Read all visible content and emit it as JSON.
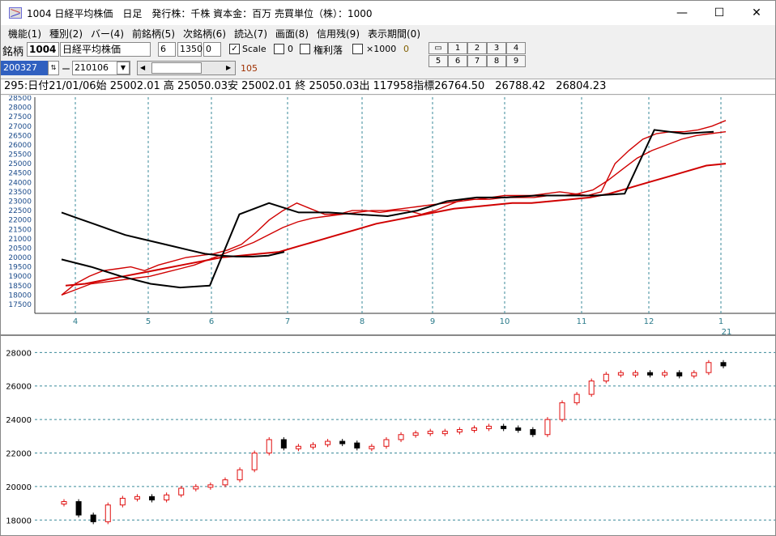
{
  "window": {
    "title": "1004 日経平均株価　日足　発行株：千株 資本金：百万 売買単位（株）：1000",
    "minimize": "—",
    "maximize": "☐",
    "close": "✕"
  },
  "menu": [
    {
      "label": "機能(1)"
    },
    {
      "label": "種別(2)"
    },
    {
      "label": "バー(4)"
    },
    {
      "label": "前銘柄(5)"
    },
    {
      "label": "次銘柄(6)"
    },
    {
      "label": "読込(7)"
    },
    {
      "label": "画面(8)"
    },
    {
      "label": "信用残(9)"
    },
    {
      "label": "表示期間(0)"
    }
  ],
  "toolbar": {
    "code_label": "銘柄",
    "code_value": "1004",
    "name_value": "日経平均株価",
    "param1": "6",
    "param2": "1350",
    "param3": "0",
    "scale_checked": "✓",
    "scale_label": "Scale",
    "zero_label": "0",
    "rights_label": "権利落",
    "x1000_label": "×1000",
    "x1000_value": "0",
    "start_date": "200327",
    "dash": "ー",
    "end_date": "210106",
    "dropdown_arrow": "▼",
    "scroll_left": "◀",
    "scroll_right": "▶",
    "count": "105",
    "num_buttons": [
      "1",
      "2",
      "3",
      "4",
      "5",
      "6",
      "7",
      "8",
      "9"
    ],
    "candle_button": "▭"
  },
  "info": {
    "text": "295:日付21/01/06始 25002.01 高 25050.03安 25002.01 終 25050.03出 117958指標26764.50　26788.42　26804.23"
  },
  "colors": {
    "up_candle": "#e01010",
    "down_candle": "#000000",
    "ma_red": "#d00000",
    "ma_black": "#000000",
    "grid": "#3a8a9a",
    "axis_label_blue": "#1a4a8a",
    "axis_label_teal": "#2a7a8a"
  },
  "chart_data": [
    {
      "type": "line",
      "title": "",
      "ylim": [
        17500,
        28500
      ],
      "y_ticks": [
        17500,
        18000,
        18500,
        19000,
        19500,
        20000,
        20500,
        21000,
        21500,
        22000,
        22500,
        23000,
        23500,
        24000,
        24500,
        25000,
        25500,
        26000,
        26500,
        27000,
        27500,
        28000,
        28500
      ],
      "x_month_labels": [
        "4",
        "5",
        "6",
        "7",
        "8",
        "9",
        "10",
        "11",
        "12",
        "1"
      ],
      "year_label": "21",
      "series": [
        {
          "values": [
            18000,
            18600,
            19000,
            19300,
            19400,
            19500,
            19300,
            19600,
            19800,
            20000,
            20100,
            20200,
            20400,
            20700,
            21300,
            22000,
            22500,
            22900,
            22600,
            22300,
            22300,
            22500,
            22500,
            22400,
            22500,
            22500,
            22300,
            22500,
            22800,
            23100,
            23100,
            23200,
            23300,
            23300,
            23300,
            23400,
            23500,
            23400,
            23300,
            23500,
            25000,
            25700,
            26300,
            26600,
            26700,
            26700,
            26800,
            27000,
            27300
          ]
        },
        {
          "values": [
            18000,
            18300,
            18600,
            18700,
            18800,
            18900,
            19000,
            19200,
            19400,
            19600,
            19900,
            20200,
            20500,
            20800,
            21200,
            21600,
            21900,
            22100,
            22200,
            22300,
            22400,
            22500,
            22500,
            22600,
            22700,
            22800,
            22900,
            23000,
            23100,
            23100,
            23200,
            23200,
            23200,
            23300,
            23300,
            23400,
            23600,
            24100,
            24700,
            25300,
            25700,
            26000,
            26300,
            26500,
            26600,
            26700
          ]
        },
        {
          "values": [
            18500,
            18600,
            18800,
            19000,
            19200,
            19400,
            19600,
            19800,
            20000,
            20100,
            20200,
            20300,
            20600,
            20900,
            21200,
            21500,
            21800,
            22000,
            22200,
            22400,
            22600,
            22700,
            22800,
            22900,
            22900,
            23000,
            23100,
            23200,
            23400,
            23700,
            24000,
            24300,
            24600,
            24900,
            25000
          ]
        },
        {
          "values": [
            22400,
            22100,
            21800,
            21500,
            21200,
            21000,
            20800,
            20600,
            20400,
            20200,
            20100,
            20050,
            20050,
            20100,
            20300
          ]
        },
        {
          "values": [
            19900,
            19500,
            19000,
            18600,
            18400,
            18500,
            22300,
            22900,
            22400,
            22400,
            22300,
            22200,
            22500,
            23000,
            23200,
            23200,
            23300,
            23300,
            23300,
            23400,
            26800,
            26600,
            26700
          ]
        }
      ]
    },
    {
      "type": "bar",
      "title": "",
      "ylim": [
        17000,
        28500
      ],
      "y_ticks": [
        18000,
        20000,
        22000,
        24000,
        26000,
        28000
      ],
      "values": [
        19100,
        18300,
        17900,
        18900,
        19300,
        19400,
        19200,
        19500,
        19900,
        20000,
        20100,
        20400,
        21000,
        22000,
        22800,
        22300,
        22400,
        22500,
        22700,
        22600,
        22300,
        22400,
        22800,
        23100,
        23200,
        23300,
        23300,
        23400,
        23500,
        23600,
        23500,
        23400,
        23100,
        24000,
        25000,
        25500,
        26300,
        26700,
        26800,
        26800,
        26700,
        26800,
        26600,
        26800,
        27400,
        27200
      ]
    }
  ]
}
